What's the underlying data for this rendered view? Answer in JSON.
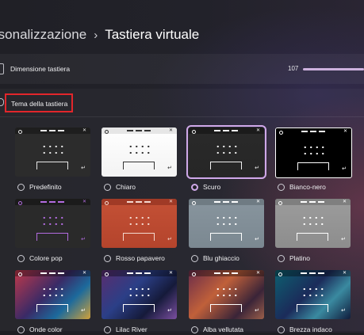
{
  "breadcrumb": {
    "parent": "rsonalizzazione",
    "separator": "›",
    "current": "Tastiera virtuale"
  },
  "keyboard_size": {
    "label": "Dimensione tastiera",
    "value": "107"
  },
  "theme_section": {
    "label": "Tema della tastiera"
  },
  "themes": [
    {
      "label": "Predefinito",
      "selected": false
    },
    {
      "label": "Chiaro",
      "selected": false
    },
    {
      "label": "Scuro",
      "selected": true
    },
    {
      "label": "Bianco-nero",
      "selected": false
    },
    {
      "label": "Colore pop",
      "selected": false
    },
    {
      "label": "Rosso papavero",
      "selected": false
    },
    {
      "label": "Blu ghiaccio",
      "selected": false
    },
    {
      "label": "Platino",
      "selected": false
    },
    {
      "label": "Onde color",
      "selected": false
    },
    {
      "label": "Lilac River",
      "selected": false
    },
    {
      "label": "Alba vellutata",
      "selected": false
    },
    {
      "label": "Brezza indaco",
      "selected": false
    }
  ],
  "colors": {
    "accent": "#cfa8e8",
    "highlight_box": "#e2262b",
    "slider": "#cdb1de"
  }
}
